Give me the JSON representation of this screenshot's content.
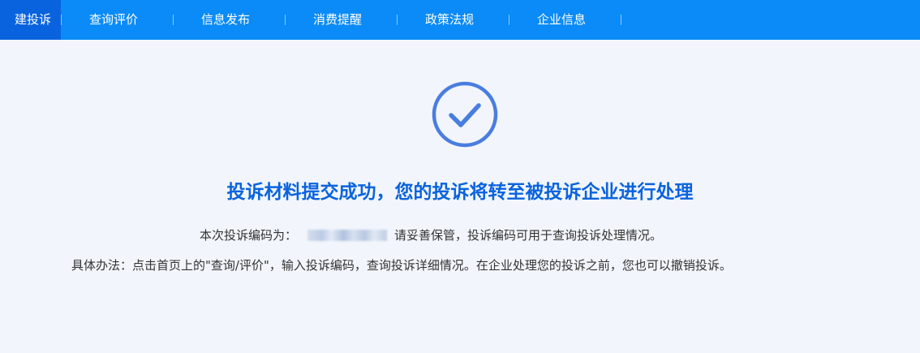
{
  "nav": {
    "items": [
      {
        "label": "投诉",
        "prefix": "建",
        "active": true
      },
      {
        "label": "查询评价",
        "active": false
      },
      {
        "label": "信息发布",
        "active": false
      },
      {
        "label": "消费提醒",
        "active": false
      },
      {
        "label": "政策法规",
        "active": false
      },
      {
        "label": "企业信息",
        "active": false
      }
    ]
  },
  "result": {
    "icon": "check-circle-icon",
    "headline": "投诉材料提交成功，您的投诉将转至被投诉企业进行处理",
    "code_prefix": "本次投诉编码为：",
    "code_value": "",
    "code_suffix": "请妥善保管，投诉编码可用于查询投诉处理情况。",
    "instructions": "具体办法：点击首页上的\"查询/评价\"，输入投诉编码，查询投诉详细情况。在企业处理您的投诉之前，您也可以撤销投诉。"
  },
  "colors": {
    "nav_bg": "#0a8bf7",
    "nav_active_bg": "#0a63de",
    "page_bg": "#f2f6fc",
    "accent": "#0a63de",
    "icon": "#4a7de0",
    "text": "#333333"
  }
}
